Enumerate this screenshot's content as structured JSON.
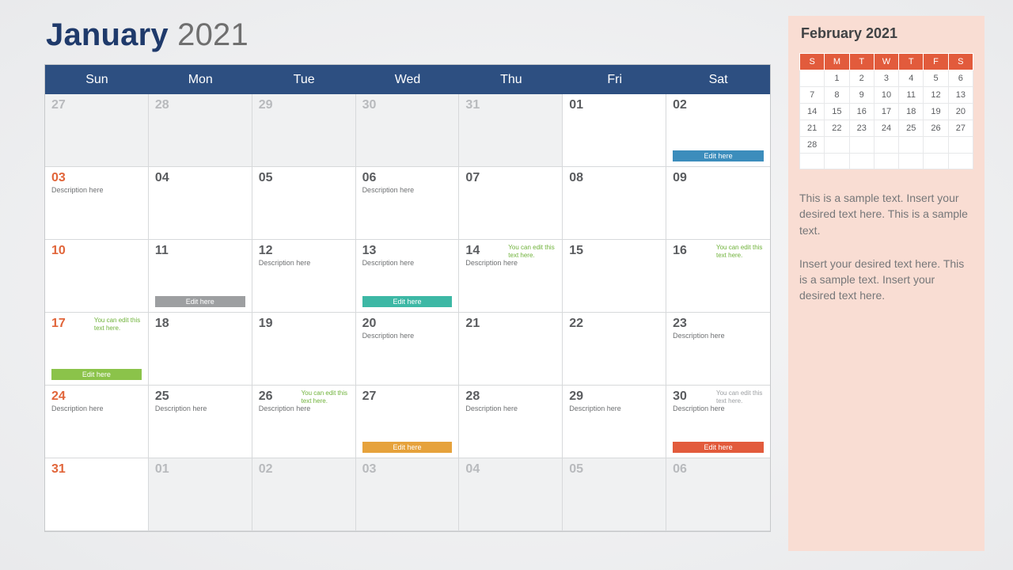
{
  "title": {
    "month": "January",
    "year": "2021"
  },
  "dayHeaders": [
    "Sun",
    "Mon",
    "Tue",
    "Wed",
    "Thu",
    "Fri",
    "Sat"
  ],
  "editLabel": "Edit here",
  "noteText": "You can edit this text here.",
  "descText": "Description here",
  "weeks": [
    [
      {
        "n": "27",
        "out": true
      },
      {
        "n": "28",
        "out": true
      },
      {
        "n": "29",
        "out": true
      },
      {
        "n": "30",
        "out": true
      },
      {
        "n": "31",
        "out": true
      },
      {
        "n": "01"
      },
      {
        "n": "02",
        "tag": "blue"
      }
    ],
    [
      {
        "n": "03",
        "sun": true,
        "desc": true
      },
      {
        "n": "04"
      },
      {
        "n": "05"
      },
      {
        "n": "06",
        "desc": true
      },
      {
        "n": "07"
      },
      {
        "n": "08"
      },
      {
        "n": "09"
      }
    ],
    [
      {
        "n": "10",
        "sun": true
      },
      {
        "n": "11",
        "tag": "grey"
      },
      {
        "n": "12",
        "desc": true
      },
      {
        "n": "13",
        "desc": true,
        "tag": "teal"
      },
      {
        "n": "14",
        "note": "green",
        "desc": true
      },
      {
        "n": "15"
      },
      {
        "n": "16",
        "note": "green"
      }
    ],
    [
      {
        "n": "17",
        "sun": true,
        "note": "green",
        "tag": "green"
      },
      {
        "n": "18"
      },
      {
        "n": "19"
      },
      {
        "n": "20",
        "desc": true
      },
      {
        "n": "21"
      },
      {
        "n": "22"
      },
      {
        "n": "23",
        "desc": true
      }
    ],
    [
      {
        "n": "24",
        "sun": true,
        "desc": true
      },
      {
        "n": "25",
        "desc": true
      },
      {
        "n": "26",
        "note": "green",
        "desc": true
      },
      {
        "n": "27",
        "tag": "orange"
      },
      {
        "n": "28",
        "desc": true
      },
      {
        "n": "29",
        "desc": true
      },
      {
        "n": "30",
        "note": "grey",
        "desc": true,
        "tag": "red"
      }
    ],
    [
      {
        "n": "31",
        "sun": true
      },
      {
        "n": "01",
        "out": true
      },
      {
        "n": "02",
        "out": true
      },
      {
        "n": "03",
        "out": true
      },
      {
        "n": "04",
        "out": true
      },
      {
        "n": "05",
        "out": true
      },
      {
        "n": "06",
        "out": true
      }
    ]
  ],
  "side": {
    "title": "February 2021",
    "miniHeaders": [
      "S",
      "M",
      "T",
      "W",
      "T",
      "F",
      "S"
    ],
    "miniWeeks": [
      [
        "",
        "1",
        "2",
        "3",
        "4",
        "5",
        "6"
      ],
      [
        "7",
        "8",
        "9",
        "10",
        "11",
        "12",
        "13"
      ],
      [
        "14",
        "15",
        "16",
        "17",
        "18",
        "19",
        "20"
      ],
      [
        "21",
        "22",
        "23",
        "24",
        "25",
        "26",
        "27"
      ],
      [
        "28",
        "",
        "",
        "",
        "",
        "",
        ""
      ],
      [
        "",
        "",
        "",
        "",
        "",
        "",
        ""
      ]
    ],
    "para1": "This is a sample text. Insert your desired text here. This is a sample text.",
    "para2": "Insert your desired text here. This is a sample text. Insert your desired text here."
  }
}
